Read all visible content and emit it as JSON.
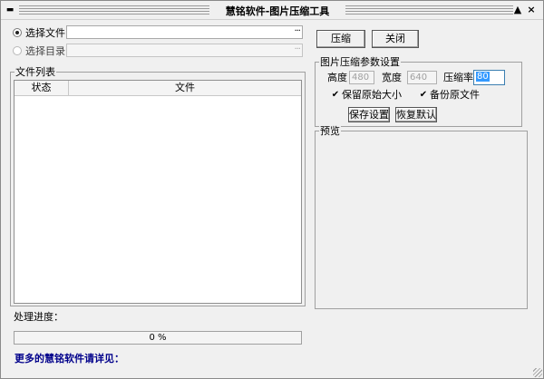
{
  "window": {
    "title": "慧铭软件-图片压缩工具",
    "sysmenu_icon": "system-menu-icon",
    "minimize_glyph": "▲",
    "close_glyph": "×"
  },
  "source": {
    "select_file_label": "选择文件",
    "select_dir_label": "选择目录",
    "file_path_value": "",
    "dir_path_value": "",
    "browse_glyph": "···",
    "selected": "file"
  },
  "file_list": {
    "title": "文件列表",
    "columns": [
      "状态",
      "文件"
    ],
    "rows": []
  },
  "actions": {
    "compress_label": "压缩",
    "close_label": "关闭"
  },
  "params": {
    "title": "图片压缩参数设置",
    "height_label": "高度",
    "height_value": "480",
    "width_label": "宽度",
    "width_value": "640",
    "rate_label": "压缩率",
    "rate_value": "80",
    "keep_size_label": "保留原始大小",
    "keep_size_checked": true,
    "backup_label": "备份原文件",
    "backup_checked": true,
    "save_label": "保存设置",
    "restore_label": "恢复默认"
  },
  "preview": {
    "title": "预览"
  },
  "progress": {
    "label": "处理进度：",
    "percent": 0,
    "percent_text": "0 %"
  },
  "footer": {
    "link_text": "更多的慧铭软件请详见："
  },
  "colors": {
    "window_bg": "#f0f0f0",
    "link": "#00008b",
    "rate_highlight": "#3399ff"
  }
}
